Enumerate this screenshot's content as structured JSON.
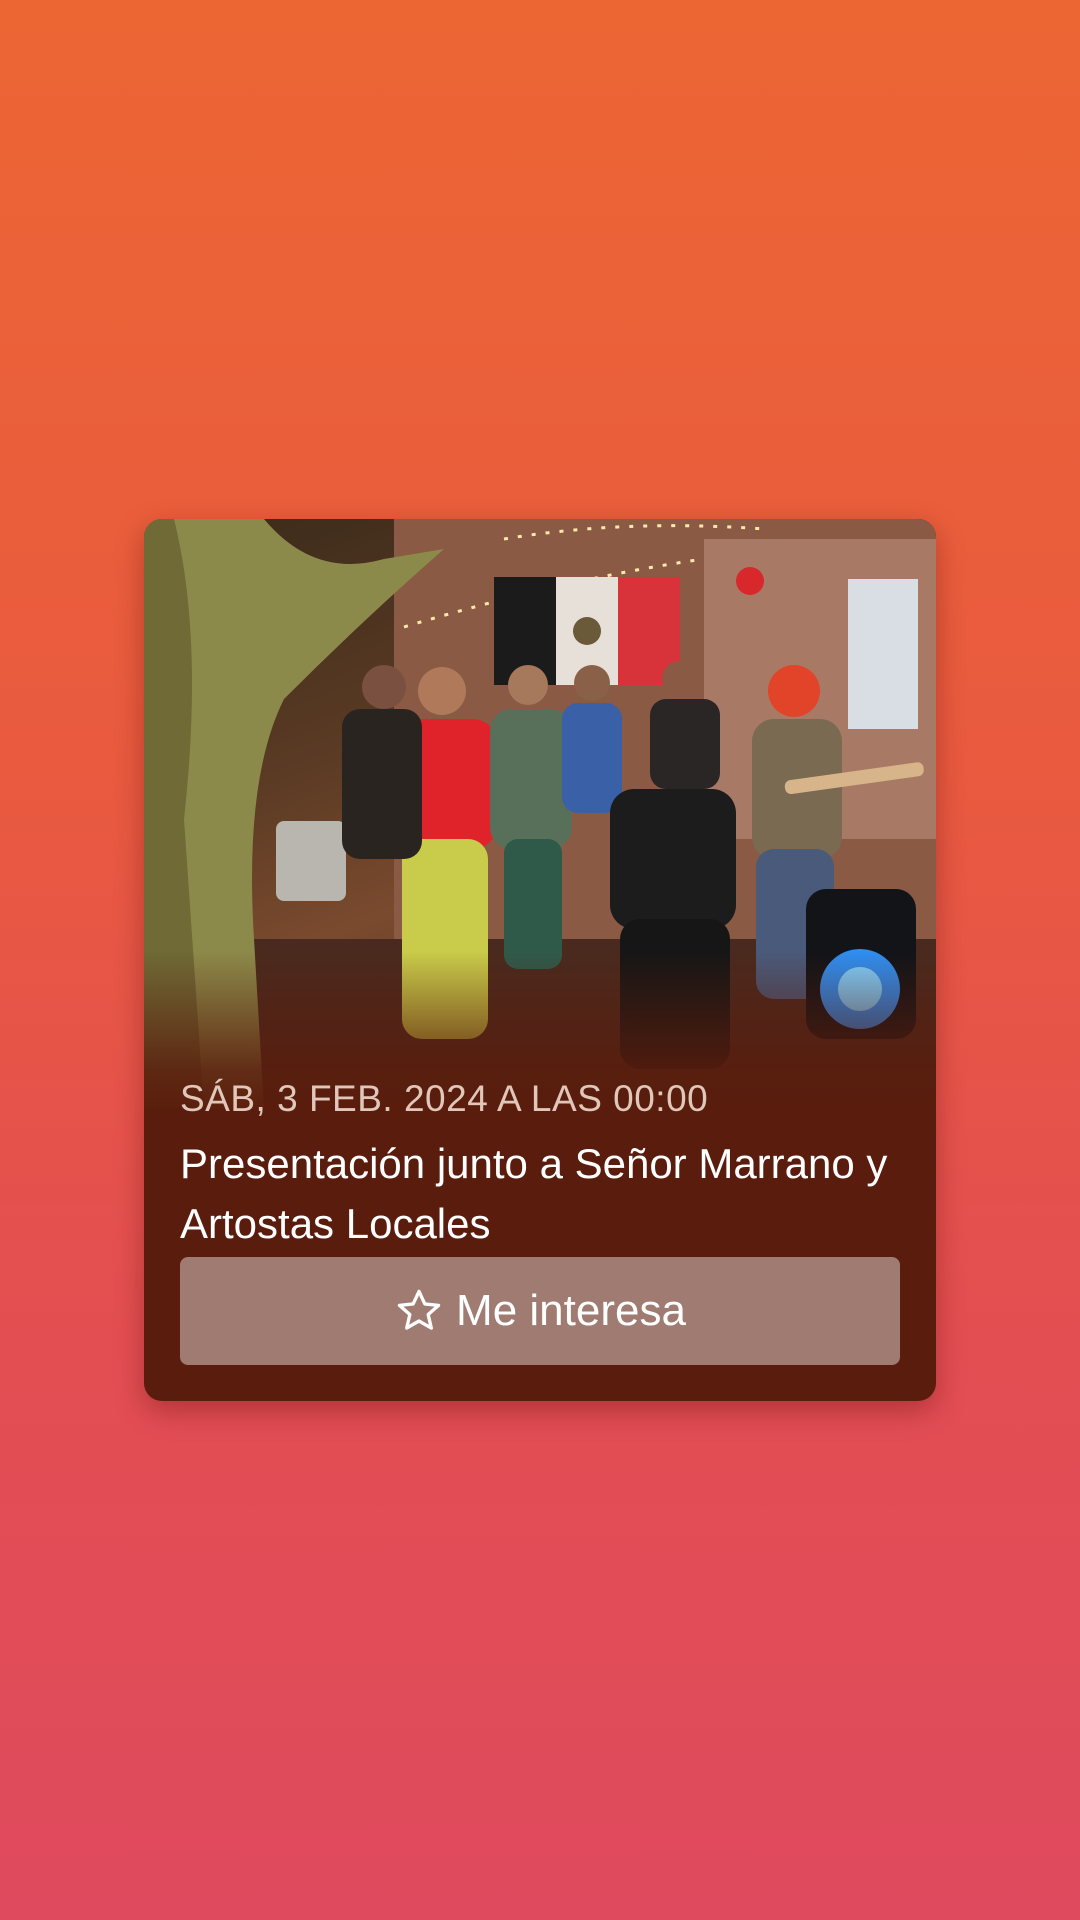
{
  "event": {
    "date": "SÁB, 3 FEB. 2024 A LAS 00:00",
    "title": "Presentación junto a Señor Marrano y Artostas Locales",
    "photo_alt": "Band performing outdoors at night",
    "interest_button": {
      "icon": "star-outline-icon",
      "label": "Me interesa"
    }
  },
  "colors": {
    "background_top": "#ec6634",
    "background_bottom": "#df4a5e",
    "card_background": "#5a1c0c",
    "button_background": "rgba(255,255,255,0.42)"
  }
}
